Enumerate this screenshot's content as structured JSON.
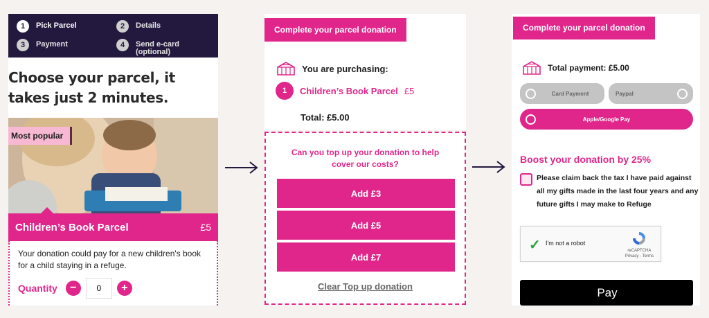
{
  "colors": {
    "brand_pink": "#e0268a",
    "navy": "#23193f",
    "badge_pink": "#f7b8d3"
  },
  "panel1": {
    "steps": [
      {
        "num": "1",
        "label": "Pick Parcel"
      },
      {
        "num": "2",
        "label": "Details"
      },
      {
        "num": "3",
        "label": "Payment"
      },
      {
        "num": "4",
        "label": "Send e-card",
        "sublabel": "(optional)"
      }
    ],
    "heading": "Choose your parcel, it takes just 2 minutes.",
    "badge": "Most popular",
    "parcel_name": "Children’s Book Parcel",
    "parcel_price": "£5",
    "description": "Your donation could pay for a new children's book for a child staying in a refuge.",
    "quantity_label": "Quantity",
    "quantity_value": "0",
    "minus": "−",
    "plus": "+"
  },
  "panel2": {
    "title": "Complete your parcel donation",
    "purchasing": "You are purchasing:",
    "item_num": "1",
    "item_name": "Children’s Book Parcel",
    "item_price": "£5",
    "total": "Total: £5.00",
    "topup_question": "Can you top up your donation to help cover our costs?",
    "buttons": [
      "Add £3",
      "Add £5",
      "Add £7"
    ],
    "clear": "Clear Top up donation"
  },
  "panel3": {
    "title": "Complete your parcel donation",
    "total_payment": "Total payment: £5.00",
    "options": [
      "Card Payment",
      "Paypal",
      "Apple/Google Pay"
    ],
    "boost": "Boost your donation by 25%",
    "claim_text": "Please claim back the tax I have paid against all my gifts made in the last four years and any future gifts I may make to Refuge",
    "captcha_label": "I'm not a robot",
    "captcha_brand": "reCAPTCHA",
    "captcha_links": "Privacy - Terms",
    "pay_button": "Pay",
    "apple_glyph": ""
  }
}
